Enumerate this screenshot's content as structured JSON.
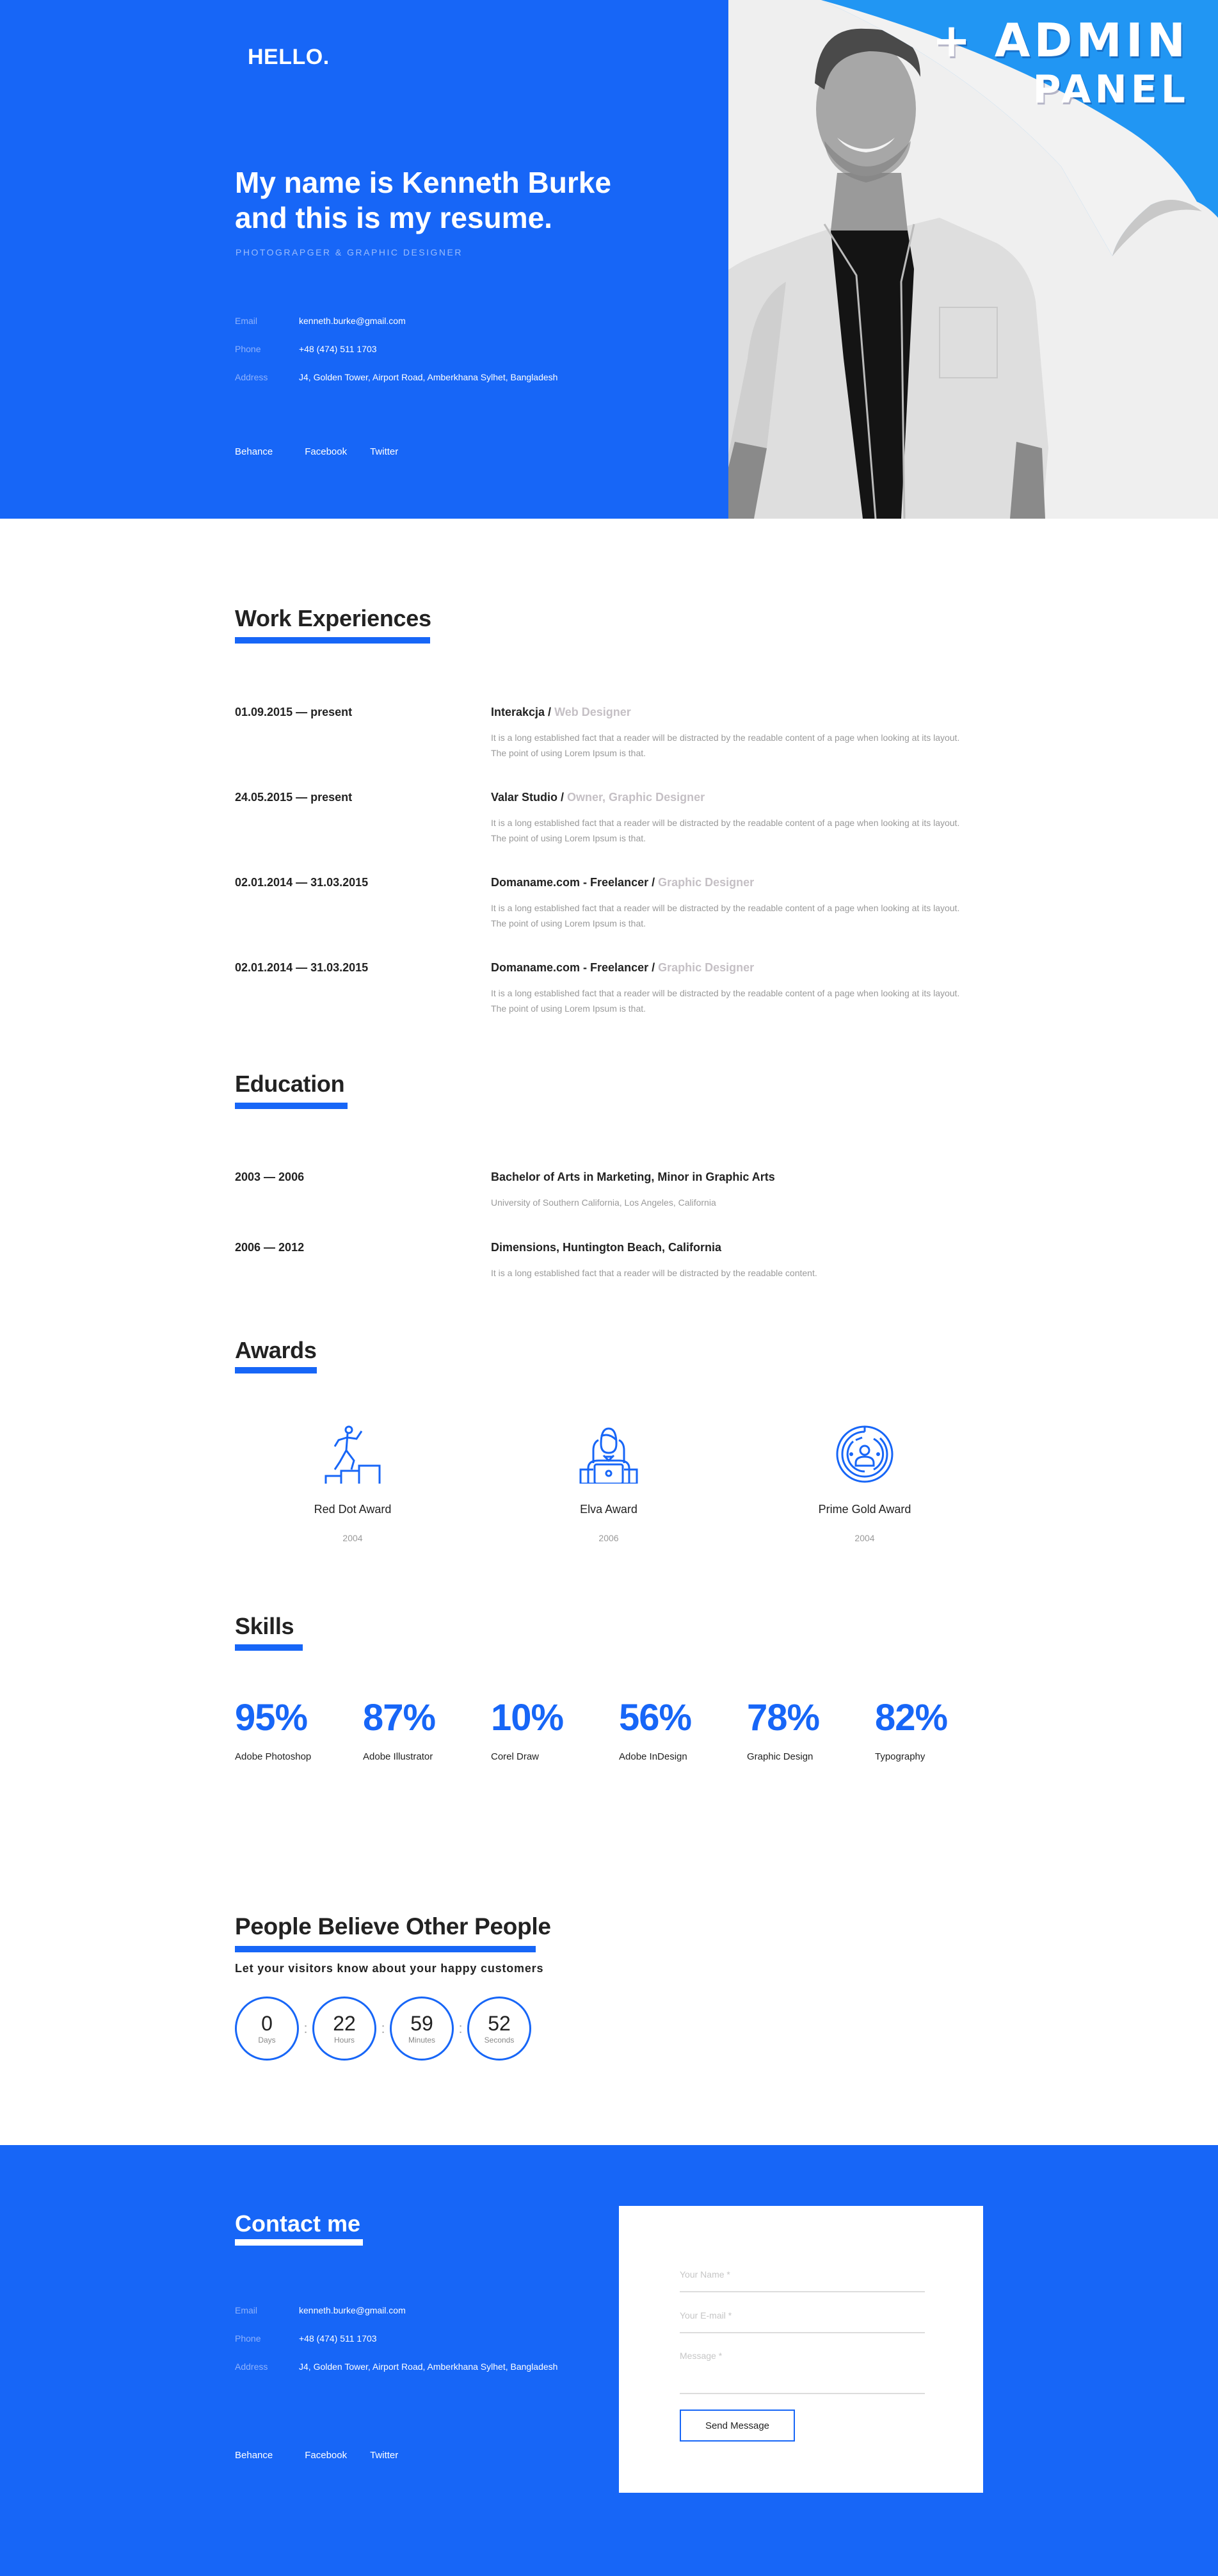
{
  "hero": {
    "greeting": "HELLO.",
    "title": "My name is Kenneth Burke and this is my resume.",
    "subtitle": "PHOTOGRAPGER & GRAPHIC DESIGNER",
    "contact": [
      {
        "label": "Email",
        "value": "kenneth.burke@gmail.com"
      },
      {
        "label": "Phone",
        "value": "+48 (474) 511 1703"
      },
      {
        "label": "Address",
        "value": "J4, Golden Tower, Airport Road, Amberkhana Sylhet, Bangladesh"
      }
    ],
    "social": [
      "Behance",
      "Facebook",
      "Twitter"
    ],
    "promo": {
      "line1": "+ ADMIN",
      "line2": "PANEL"
    },
    "accent_color": "#1766f7",
    "promo_color": "#2196f3"
  },
  "work": {
    "title": "Work Experiences",
    "items": [
      {
        "date": "01.09.2015 — present",
        "company": "Interakcja / ",
        "role": "Web Designer",
        "desc": "It is a long established fact that a reader will be distracted by the readable content of a page when looking at its layout. The point of using Lorem Ipsum is that."
      },
      {
        "date": "24.05.2015 — present",
        "company": "Valar Studio / ",
        "role": "Owner, Graphic Designer",
        "desc": "It is a long established fact that a reader will be distracted by the readable content of a page when looking at its layout. The point of using Lorem Ipsum is that."
      },
      {
        "date": "02.01.2014 — 31.03.2015",
        "company": "Domaname.com - Freelancer / ",
        "role": "Graphic Designer",
        "desc": "It is a long established fact that a reader will be distracted by the readable content of a page when looking at its layout. The point of using Lorem Ipsum is that."
      },
      {
        "date": "02.01.2014 — 31.03.2015",
        "company": "Domaname.com - Freelancer / ",
        "role": "Graphic Designer",
        "desc": "It is a long established fact that a reader will be distracted by the readable content of a page when looking at its layout. The point of using Lorem Ipsum is that."
      }
    ]
  },
  "education": {
    "title": "Education",
    "items": [
      {
        "date": "2003 — 2006",
        "title": "Bachelor of Arts in Marketing, Minor in Graphic Arts",
        "desc": "University of Southern California, Los Angeles, California"
      },
      {
        "date": "2006 — 2012",
        "title": "Dimensions, Huntington Beach, California",
        "desc": "It is a long established fact that a reader will be distracted by the readable content."
      }
    ]
  },
  "awards": {
    "title": "Awards",
    "items": [
      {
        "icon": "running-stairs-icon",
        "name": "Red Dot Award",
        "year": "2004"
      },
      {
        "icon": "person-laptop-icon",
        "name": "Elva Award",
        "year": "2006"
      },
      {
        "icon": "target-person-icon",
        "name": "Prime Gold Award",
        "year": "2004"
      }
    ]
  },
  "skills": {
    "title": "Skills",
    "items": [
      {
        "percent": "95%",
        "name": "Adobe Photoshop"
      },
      {
        "percent": "87%",
        "name": "Adobe Illustrator"
      },
      {
        "percent": "10%",
        "name": "Corel Draw"
      },
      {
        "percent": "56%",
        "name": "Adobe InDesign"
      },
      {
        "percent": "78%",
        "name": "Graphic Design"
      },
      {
        "percent": "82%",
        "name": "Typography"
      }
    ]
  },
  "testimonials": {
    "title": "People Believe Other People",
    "tagline": "Let your visitors know about your happy customers",
    "countdown": [
      {
        "value": "0",
        "unit": "Days"
      },
      {
        "value": "22",
        "unit": "Hours"
      },
      {
        "value": "59",
        "unit": "Minutes"
      },
      {
        "value": "52",
        "unit": "Seconds"
      }
    ],
    "separator": ":"
  },
  "contact": {
    "title": "Contact me",
    "info": [
      {
        "label": "Email",
        "value": "kenneth.burke@gmail.com"
      },
      {
        "label": "Phone",
        "value": "+48 (474) 511 1703"
      },
      {
        "label": "Address",
        "value": "J4, Golden Tower, Airport Road, Amberkhana Sylhet, Bangladesh"
      }
    ],
    "social": [
      "Behance",
      "Facebook",
      "Twitter"
    ],
    "form": {
      "name_placeholder": "Your Name *",
      "name_value": "",
      "email_placeholder": "Your E-mail *",
      "email_value": "",
      "message_placeholder": "Message *",
      "message_value": "",
      "submit_label": "Send Message"
    }
  }
}
